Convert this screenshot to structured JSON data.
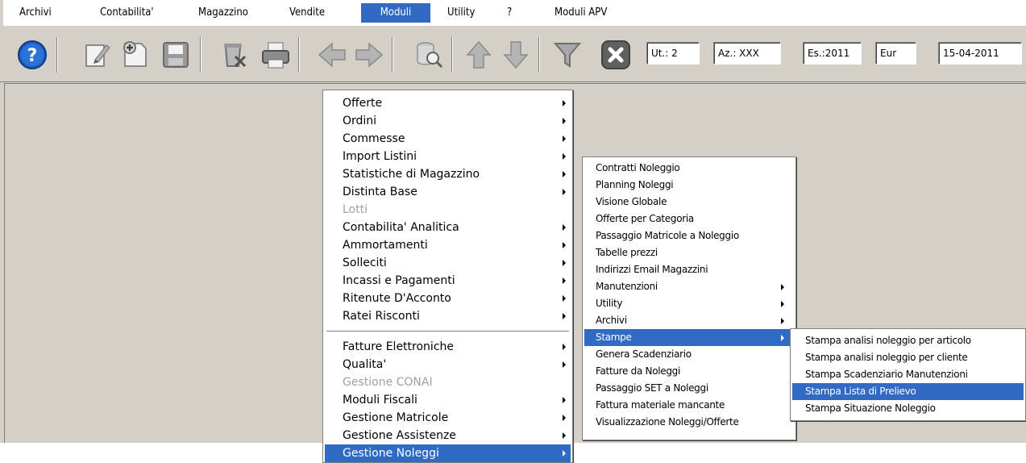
{
  "menubar": {
    "items": [
      "Archivi",
      "Contabilita'",
      "Magazzino",
      "Vendite",
      "Moduli",
      "Utility",
      "?",
      "Moduli APV"
    ]
  },
  "toolbar": {
    "icons": [
      "help-icon",
      "edit-icon",
      "new-document-icon",
      "save-icon",
      "delete-icon",
      "print-icon",
      "arrow-left-icon",
      "arrow-right-icon",
      "search-database-icon",
      "arrow-up-icon",
      "arrow-down-icon",
      "filter-icon",
      "close-icon"
    ]
  },
  "status": {
    "user": "Ut.: 2",
    "company": "Az.: XXX",
    "year": "Es.:2011",
    "currency": "Eur",
    "date": "15-04-2011"
  },
  "menu_moduli": {
    "items": [
      {
        "label": "Offerte",
        "submenu": true,
        "enabled": true
      },
      {
        "label": "Ordini",
        "submenu": true,
        "enabled": true
      },
      {
        "label": "Commesse",
        "submenu": true,
        "enabled": true
      },
      {
        "label": "Import Listini",
        "submenu": true,
        "enabled": true
      },
      {
        "label": "Statistiche di Magazzino",
        "submenu": true,
        "enabled": true
      },
      {
        "label": "Distinta Base",
        "submenu": true,
        "enabled": true
      },
      {
        "label": "Lotti",
        "submenu": false,
        "enabled": false
      },
      {
        "label": "Contabilita' Analitica",
        "submenu": true,
        "enabled": true
      },
      {
        "label": "Ammortamenti",
        "submenu": true,
        "enabled": true
      },
      {
        "label": "Solleciti",
        "submenu": true,
        "enabled": true
      },
      {
        "label": "Incassi e Pagamenti",
        "submenu": true,
        "enabled": true
      },
      {
        "label": "Ritenute D'Acconto",
        "submenu": true,
        "enabled": true
      },
      {
        "label": "Ratei Risconti",
        "submenu": true,
        "enabled": true
      },
      {
        "label": "Fatture Elettroniche",
        "submenu": true,
        "enabled": true
      },
      {
        "label": "Qualita'",
        "submenu": true,
        "enabled": true
      },
      {
        "label": "Gestione CONAI",
        "submenu": false,
        "enabled": false
      },
      {
        "label": "Moduli Fiscali",
        "submenu": true,
        "enabled": true
      },
      {
        "label": "Gestione Matricole",
        "submenu": true,
        "enabled": true
      },
      {
        "label": "Gestione Assistenze",
        "submenu": true,
        "enabled": true
      },
      {
        "label": "Gestione Noleggi",
        "submenu": true,
        "enabled": true,
        "selected": true
      }
    ]
  },
  "menu_noleggi": {
    "items": [
      {
        "label": "Contratti Noleggio",
        "submenu": false
      },
      {
        "label": "Planning Noleggi",
        "submenu": false
      },
      {
        "label": "Visione Globale",
        "submenu": false
      },
      {
        "label": "Offerte per Categoria",
        "submenu": false
      },
      {
        "label": "Passaggio Matricole a Noleggio",
        "submenu": false
      },
      {
        "label": "Tabelle prezzi",
        "submenu": false
      },
      {
        "label": "Indirizzi Email Magazzini",
        "submenu": false
      },
      {
        "label": "Manutenzioni",
        "submenu": true
      },
      {
        "label": "Utility",
        "submenu": true
      },
      {
        "label": "Archivi",
        "submenu": true
      },
      {
        "label": "Stampe",
        "submenu": true,
        "selected": true
      },
      {
        "label": "Genera Scadenziario",
        "submenu": false
      },
      {
        "label": "Fatture da Noleggi",
        "submenu": false
      },
      {
        "label": "Passaggio SET a Noleggi",
        "submenu": false
      },
      {
        "label": "Fattura materiale mancante",
        "submenu": false
      },
      {
        "label": "Visualizzazione Noleggi/Offerte",
        "submenu": false
      }
    ]
  },
  "menu_stampe": {
    "items": [
      {
        "label": "Stampa analisi noleggio per articolo"
      },
      {
        "label": "Stampa analisi noleggio per cliente"
      },
      {
        "label": "Stampa Scadenziario Manutenzioni"
      },
      {
        "label": "Stampa Lista di Prelievo",
        "selected": true
      },
      {
        "label": "Stampa Situazione Noleggio"
      }
    ]
  },
  "colors": {
    "highlight": "#316ac5",
    "face": "#d4d0c8",
    "disabled_text": "#a0a0a0"
  }
}
